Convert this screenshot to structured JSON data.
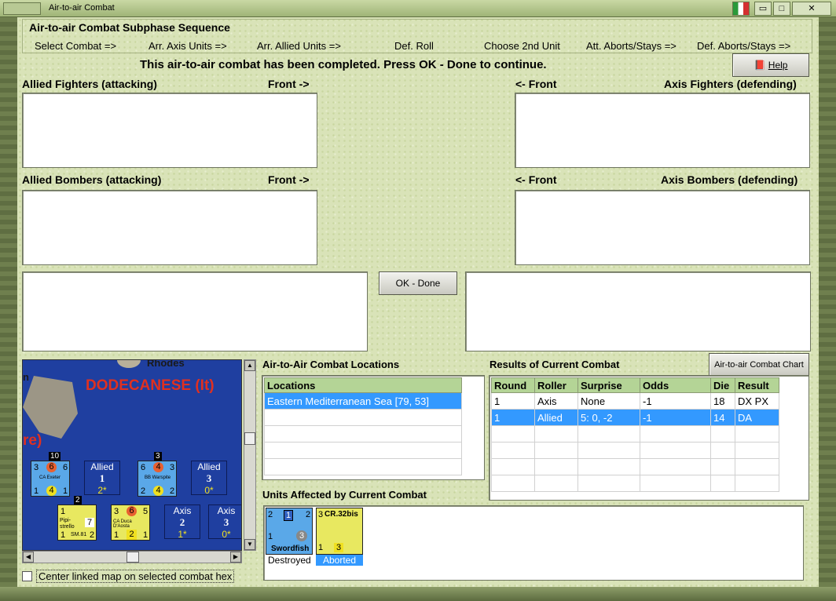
{
  "window": {
    "title": "Air-to-air Combat"
  },
  "sequence": {
    "title": "Air-to-air Combat Subphase Sequence",
    "steps": [
      "Select Combat =>",
      "Arr. Axis Units =>",
      "Arr. Allied Units =>",
      "Def. Roll",
      "Choose 2nd Unit",
      "Att. Aborts/Stays =>",
      "Def. Aborts/Stays =>"
    ]
  },
  "status_message": "This air-to-air combat has been completed.  Press OK - Done to continue.",
  "help_label": "Help",
  "labels": {
    "allied_fighters": "Allied Fighters (attacking)",
    "front_right": "Front ->",
    "front_left": "<- Front",
    "axis_fighters": "Axis Fighters (defending)",
    "allied_bombers": "Allied Bombers (attacking)",
    "axis_bombers": "Axis Bombers (defending)"
  },
  "ok_done_label": "OK - Done",
  "map": {
    "place_label": "DODECANESE (It)",
    "city_label": "Rhodes",
    "edge_text_1": "n",
    "edge_text_2": "re)",
    "units": [
      {
        "name": "CA Exeter",
        "left": "3",
        "center": "6",
        "right": "6",
        "bottom_left": "1",
        "bottom_center": "4",
        "bottom_right": "1",
        "stack": "10"
      },
      {
        "name": "BB Warspite",
        "left": "6",
        "center": "4",
        "right": "3",
        "bottom_left": "2",
        "bottom_center": "4",
        "bottom_right": "2",
        "stack": "3"
      },
      {
        "name": "SM.81",
        "top_left": "1",
        "sub": "Pipi-strello",
        "right": "7",
        "bottom_left": "1",
        "bottom_right": "2",
        "stack": "2"
      },
      {
        "name": "CA Duca D'Aosta",
        "left": "3",
        "center": "6",
        "right": "5",
        "bottom_left": "1",
        "bottom_center": "2",
        "bottom_right": "1"
      }
    ],
    "stats": [
      {
        "side": "Allied",
        "value": "1",
        "sub": "2*"
      },
      {
        "side": "Allied",
        "value": "3",
        "sub": "0*"
      },
      {
        "side": "Axis",
        "value": "2",
        "sub": "1*"
      },
      {
        "side": "Axis",
        "value": "3",
        "sub": "0*"
      }
    ]
  },
  "center_checkbox_label": "Center linked map on selected combat hex",
  "locations": {
    "title": "Air-to-Air Combat Locations",
    "header": "Locations",
    "rows": [
      "Eastern Mediterranean Sea [79, 53]"
    ]
  },
  "results": {
    "title": "Results of Current Combat",
    "chart_button": "Air-to-air Combat Chart",
    "columns": [
      "Round",
      "Roller",
      "Surprise",
      "Odds",
      "Die",
      "Result"
    ],
    "rows": [
      [
        "1",
        "Axis",
        "None",
        "-1",
        "18",
        "DX PX"
      ],
      [
        "1",
        "Allied",
        "5: 0, -2",
        "-1",
        "14",
        "DA"
      ]
    ]
  },
  "affected": {
    "title": "Units Affected by Current Combat",
    "units": [
      {
        "name": "Swordfish",
        "top_left": "2",
        "top_center": "1",
        "top_right": "2",
        "badge": "3",
        "bottom_left": "1",
        "status": "Destroyed"
      },
      {
        "name": "CR.32bis",
        "top_left": "3",
        "bottom_left": "1",
        "bottom_center": "3",
        "status": "Aborted"
      }
    ]
  }
}
